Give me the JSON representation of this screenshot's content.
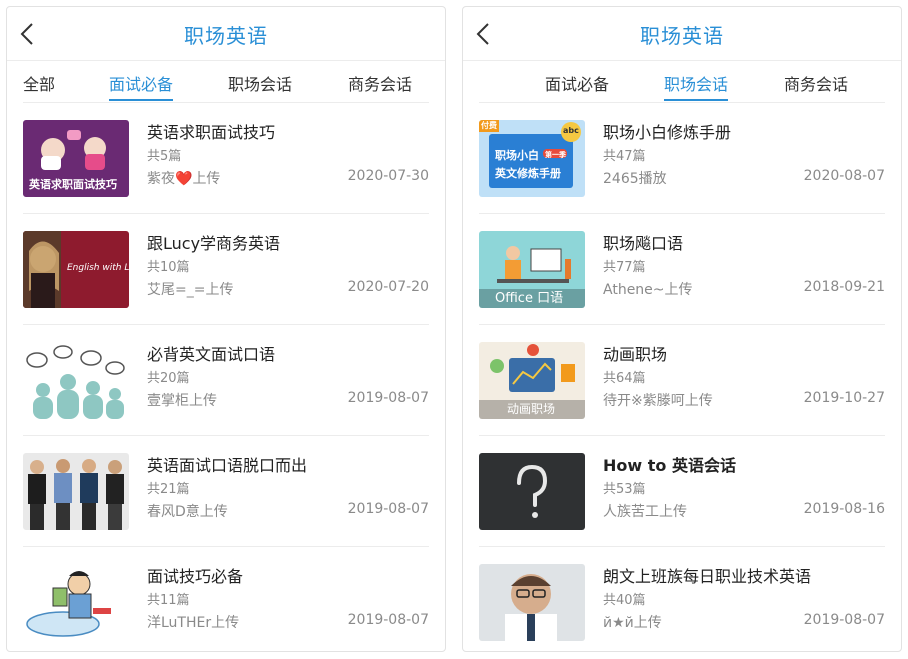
{
  "left": {
    "title": "职场英语",
    "tabs": [
      "全部",
      "面试必备",
      "职场会话",
      "商务会话"
    ],
    "active_tab": "面试必备",
    "items": [
      {
        "title": "英语求职面试技巧",
        "count": "共5篇",
        "uploader": "紫夜",
        "uploader_suffix": "上传",
        "date": "2020-07-30",
        "thumb_text": "英语求职面试技巧",
        "thumb_icon": "two-women-chatting-illustration"
      },
      {
        "title": "跟Lucy学商务英语",
        "count": "共10篇",
        "uploader": "艾尾=_=上传",
        "date": "2020-07-20",
        "thumb_text": "English with Lucy",
        "thumb_icon": "woman-portrait-photo"
      },
      {
        "title": "必背英文面试口语",
        "count": "共20篇",
        "uploader": "壹掌柜上传",
        "date": "2019-08-07",
        "thumb_icon": "people-speech-bubbles-illustration"
      },
      {
        "title": "英语面试口语脱口而出",
        "count": "共21篇",
        "uploader": "春风D意上传",
        "date": "2019-08-07",
        "thumb_icon": "interview-candidates-photo"
      },
      {
        "title": "面试技巧必备",
        "count": "共11篇",
        "uploader": "洋LuTHEr上传",
        "date": "2019-08-07",
        "thumb_icon": "cartoon-businessman-illustration"
      }
    ]
  },
  "right": {
    "title": "职场英语",
    "tabs": [
      "面试必备",
      "职场会话",
      "商务会话"
    ],
    "active_tab": "职场会话",
    "items": [
      {
        "title": "职场小白修炼手册",
        "count": "共47篇",
        "uploader": "2465播放",
        "date": "2020-08-07",
        "thumb_text": "职场小白",
        "thumb_text2": "英文修炼手册",
        "thumb_badge": "付费",
        "thumb_step": "第一季",
        "thumb_abc": "abc",
        "thumb_icon": "course-cover"
      },
      {
        "title": "职场飚口语",
        "count": "共77篇",
        "uploader": "Athene~上传",
        "date": "2018-09-21",
        "thumb_text": "Office 口语",
        "thumb_icon": "office-desk-illustration"
      },
      {
        "title": "动画职场",
        "count": "共64篇",
        "uploader": "待开※紫滕呵上传",
        "date": "2019-10-27",
        "thumb_text": "动画职场",
        "thumb_icon": "charts-tablet-illustration"
      },
      {
        "title": "How to 英语会话",
        "count": "共53篇",
        "uploader": "人族苦工上传",
        "date": "2019-08-16",
        "thumb_icon": "question-mark-chalkboard"
      },
      {
        "title": "朗文上班族每日职业技术英语",
        "count": "共40篇",
        "uploader": "й★й上传",
        "date": "2019-08-07",
        "thumb_icon": "man-glasses-photo"
      }
    ]
  },
  "colors": {
    "accent": "#2a8fd6",
    "text": "#222222",
    "muted": "#8a8a8a",
    "divider": "#ececec"
  }
}
